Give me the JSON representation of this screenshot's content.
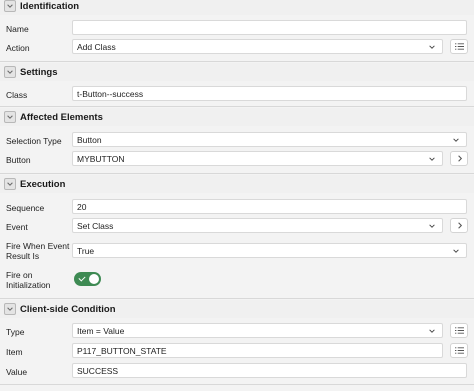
{
  "sections": {
    "identification": {
      "title": "Identification"
    },
    "settings": {
      "title": "Settings"
    },
    "affected": {
      "title": "Affected Elements"
    },
    "execution": {
      "title": "Execution"
    },
    "condition": {
      "title": "Client-side Condition"
    }
  },
  "identification": {
    "name_label": "Name",
    "name_value": "",
    "action_label": "Action",
    "action_value": "Add Class"
  },
  "settings": {
    "class_label": "Class",
    "class_value": "t-Button--success"
  },
  "affected": {
    "selection_type_label": "Selection Type",
    "selection_type_value": "Button",
    "button_label": "Button",
    "button_value": "MYBUTTON"
  },
  "execution": {
    "sequence_label": "Sequence",
    "sequence_value": "20",
    "event_label": "Event",
    "event_value": "Set Class",
    "fire_when_label_line1": "Fire When Event",
    "fire_when_label_line2": "Result Is",
    "fire_when_value": "True",
    "fire_init_label_line1": "Fire on",
    "fire_init_label_line2": "Initialization",
    "fire_init_on": true
  },
  "condition": {
    "type_label": "Type",
    "type_value": "Item = Value",
    "item_label": "Item",
    "item_value": "P117_BUTTON_STATE",
    "value_label": "Value",
    "value_value": "SUCCESS"
  },
  "colors": {
    "toggle_on": "#3e8a53",
    "field_border": "#d9d9d9",
    "background": "#f3f3f3"
  },
  "icons": [
    "chevron-down-icon",
    "list-icon",
    "chevron-right-icon",
    "checkmark-icon"
  ]
}
